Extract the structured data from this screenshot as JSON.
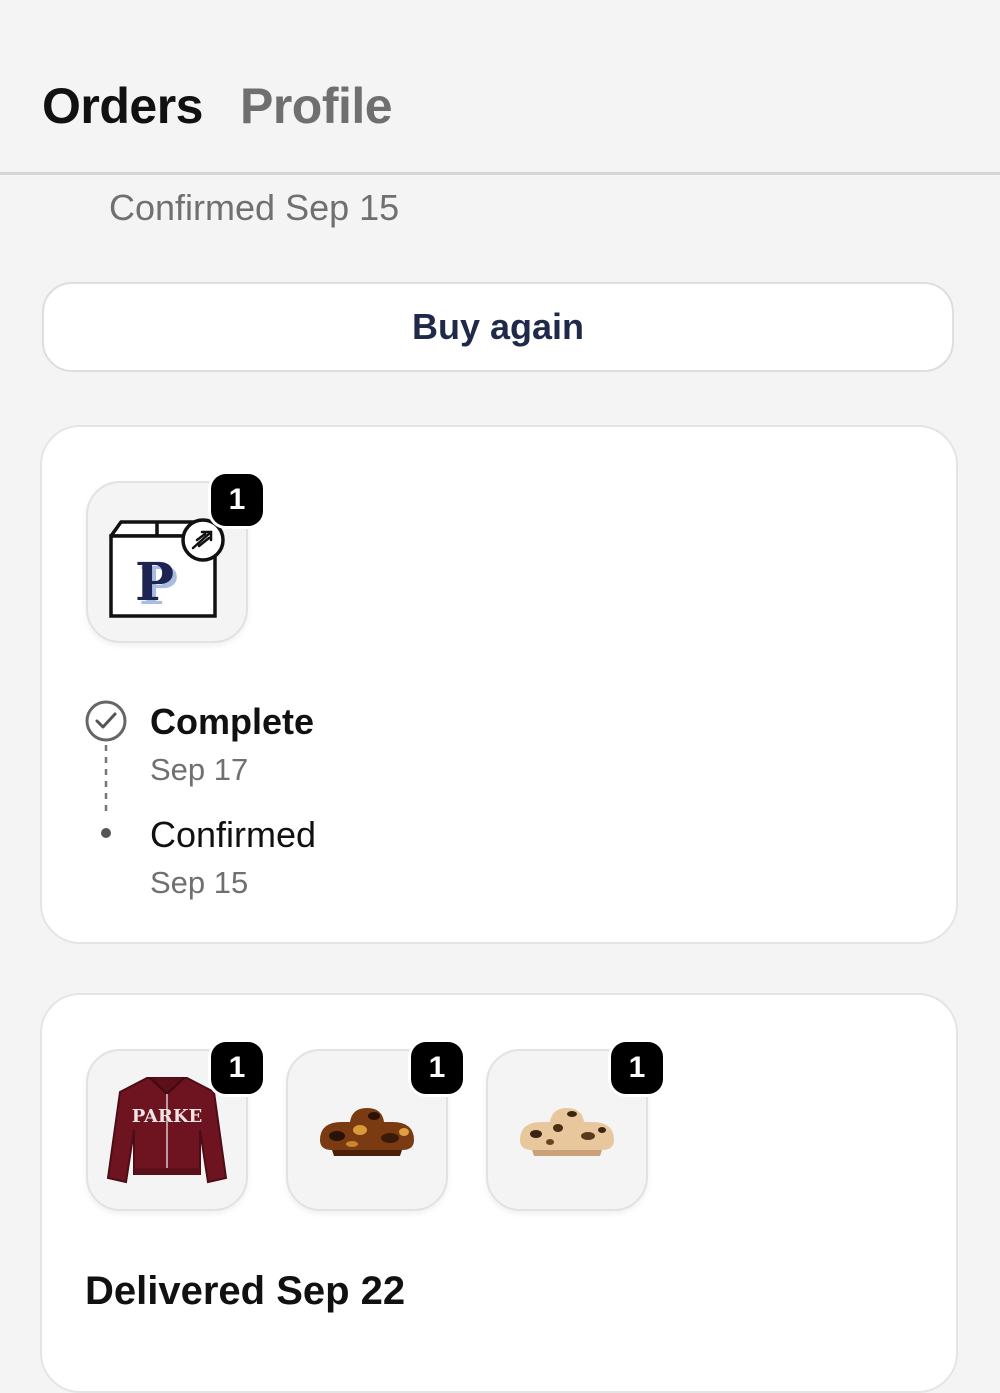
{
  "nav": {
    "tabs": [
      {
        "label": "Orders",
        "active": true
      },
      {
        "label": "Profile",
        "active": false
      }
    ]
  },
  "previous_order": {
    "status_line": "Confirmed Sep 15"
  },
  "buy_again": {
    "label": "Buy again"
  },
  "order_card": {
    "item_count": "1",
    "product_icon": "package-p-icon",
    "timeline": [
      {
        "label": "Complete",
        "date": "Sep 17",
        "icon": "check-circle-icon"
      },
      {
        "label": "Confirmed",
        "date": "Sep 15",
        "icon": "dot-icon"
      }
    ]
  },
  "delivered_card": {
    "items": [
      {
        "count": "1",
        "name": "jacket",
        "print": "PARKE"
      },
      {
        "count": "1",
        "name": "tortoise-hair-claw"
      },
      {
        "count": "1",
        "name": "blonde-tortoise-hair-claw"
      }
    ],
    "status": "Delivered Sep 22"
  },
  "colors": {
    "background": "#f4f4f4",
    "card": "#ffffff",
    "button_text": "#1f2a4a",
    "muted_text": "#707070",
    "badge": "#000000"
  }
}
